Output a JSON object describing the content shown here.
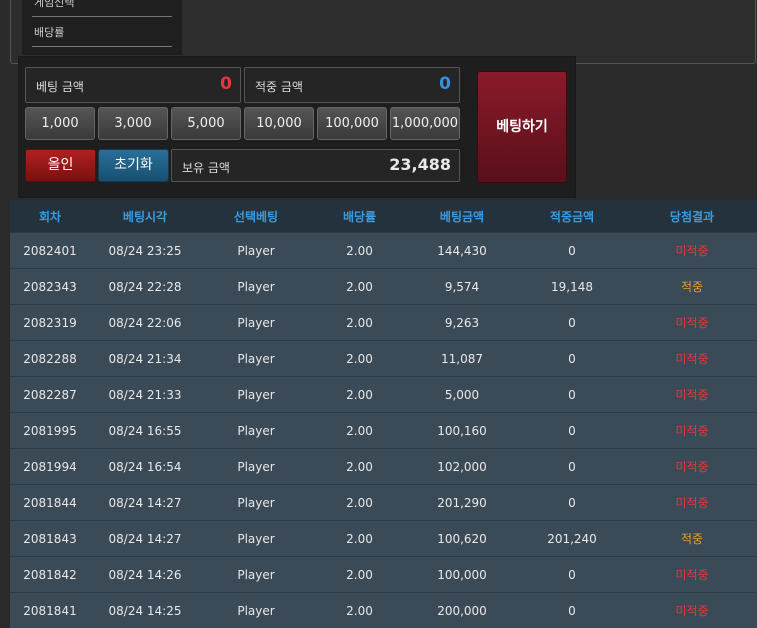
{
  "game_menu": {
    "items": [
      {
        "label": "게임선택"
      },
      {
        "label": "배당률"
      }
    ]
  },
  "bet_panel": {
    "bet_amount_label": "베팅 금액",
    "bet_amount_value": "0",
    "win_amount_label": "적중 금액",
    "win_amount_value": "0",
    "chips": [
      "1,000",
      "3,000",
      "5,000",
      "10,000",
      "100,000",
      "1,000,000"
    ],
    "all_in_label": "올인",
    "reset_label": "초기화",
    "balance_label": "보유 금액",
    "balance_value": "23,488",
    "place_bet_label": "베팅하기"
  },
  "history_table": {
    "columns": [
      "회차",
      "베팅시각",
      "선택베팅",
      "배당률",
      "베팅금액",
      "적중금액",
      "당첨결과"
    ],
    "rows": [
      [
        "2082401",
        "08/24 23:25",
        "Player",
        "2.00",
        "144,430",
        "0",
        "미적중"
      ],
      [
        "2082343",
        "08/24 22:28",
        "Player",
        "2.00",
        "9,574",
        "19,148",
        "적중"
      ],
      [
        "2082319",
        "08/24 22:06",
        "Player",
        "2.00",
        "9,263",
        "0",
        "미적중"
      ],
      [
        "2082288",
        "08/24 21:34",
        "Player",
        "2.00",
        "11,087",
        "0",
        "미적중"
      ],
      [
        "2082287",
        "08/24 21:33",
        "Player",
        "2.00",
        "5,000",
        "0",
        "미적중"
      ],
      [
        "2081995",
        "08/24 16:55",
        "Player",
        "2.00",
        "100,160",
        "0",
        "미적중"
      ],
      [
        "2081994",
        "08/24 16:54",
        "Player",
        "2.00",
        "102,000",
        "0",
        "미적중"
      ],
      [
        "2081844",
        "08/24 14:27",
        "Player",
        "2.00",
        "201,290",
        "0",
        "미적중"
      ],
      [
        "2081843",
        "08/24 14:27",
        "Player",
        "2.00",
        "100,620",
        "201,240",
        "적중"
      ],
      [
        "2081842",
        "08/24 14:26",
        "Player",
        "2.00",
        "100,000",
        "0",
        "미적중"
      ],
      [
        "2081841",
        "08/24 14:25",
        "Player",
        "2.00",
        "200,000",
        "0",
        "미적중"
      ]
    ]
  },
  "colors": {
    "header_text": "#3a9be0",
    "lose_text": "#e03a3a",
    "win_text": "#e0a030",
    "row_bg": "#3a4a57"
  }
}
